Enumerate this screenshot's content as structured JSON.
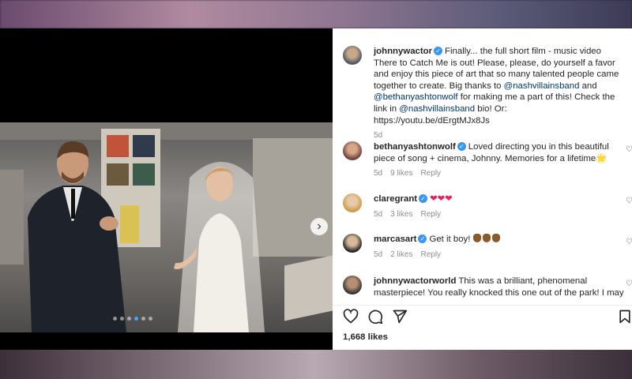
{
  "post": {
    "author": "johnnywactor",
    "caption_part1": "Finally... the full short film - music video There to Catch Me is out! Please, please, do yourself a favor and enjoy this piece of art that so many talented people came together to create. Big thanks to ",
    "caption_mention1": "@nashvillainsband",
    "caption_part2": " and ",
    "caption_mention2": "@bethanyashtonwolf",
    "caption_part3": " for making me a part of this! Check the link in ",
    "caption_mention3": "@nashvillainsband",
    "caption_part4": " bio! Or: https://youtu.be/dErgtMJx8Js",
    "time": "5d",
    "likes": "1,668 likes"
  },
  "comments": [
    {
      "user": "bethanyashtonwolf",
      "text": "Loved directing you in this beautiful piece of song + cinema, Johnny. Memories for a lifetime",
      "emoji": "🌟",
      "time": "5d",
      "likes": "9 likes",
      "reply": "Reply"
    },
    {
      "user": "claregrant",
      "text": "❤❤❤",
      "time": "5d",
      "likes": "3 likes",
      "reply": "Reply"
    },
    {
      "user": "marcasart",
      "text": "Get it boy!",
      "time": "5d",
      "likes": "2 likes",
      "reply": "Reply"
    },
    {
      "user": "johnnywactorworld",
      "text": "This was a brilliant, phenomenal masterpiece! You really knocked this one out of the park! I may"
    }
  ],
  "icons": {
    "like": "heart-icon",
    "comment": "comment-icon",
    "share": "share-icon",
    "save": "bookmark-icon",
    "next": "chevron-right-icon"
  },
  "colors": {
    "verified": "#3897f0",
    "mention": "#00376b",
    "carousel_active_dot": "#4aa3ff"
  },
  "carousel": {
    "total": 6,
    "active": 4
  }
}
